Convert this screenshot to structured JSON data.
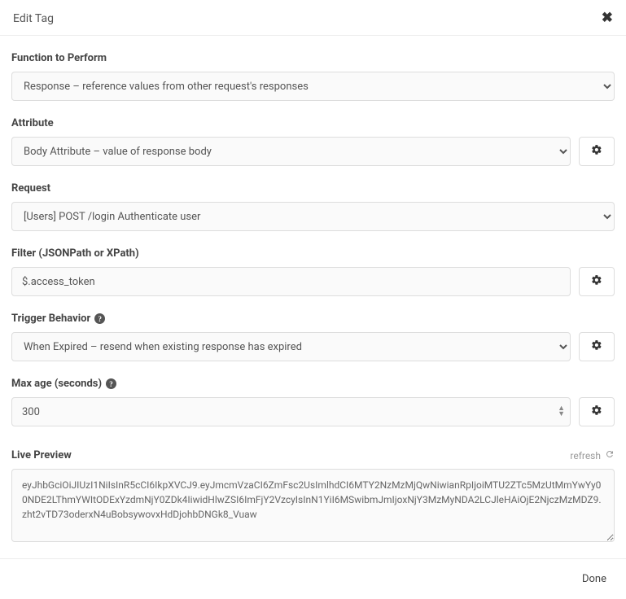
{
  "header": {
    "title": "Edit Tag"
  },
  "fields": {
    "function": {
      "label": "Function to Perform",
      "value": "Response – reference values from other request's responses"
    },
    "attribute": {
      "label": "Attribute",
      "value": "Body Attribute – value of response body"
    },
    "request": {
      "label": "Request",
      "value": "[Users] POST /login Authenticate user"
    },
    "filter": {
      "label": "Filter (JSONPath or XPath)",
      "value": "$.access_token"
    },
    "trigger": {
      "label": "Trigger Behavior",
      "value": "When Expired – resend when existing response has expired"
    },
    "maxage": {
      "label": "Max age (seconds)",
      "value": "300"
    }
  },
  "preview": {
    "label": "Live Preview",
    "refresh_label": "refresh",
    "value": "eyJhbGciOiJIUzI1NiIsInR5cCI6IkpXVCJ9.eyJmcmVzaCI6ZmFsc2UsImlhdCI6MTY2NzMzMjQwNiwianRpIjoiMTU2ZTc5MzUtMmYwYy00NDE2LThmYWItODExYzdmNjY0ZDk4IiwidHlwZSI6ImFjY2VzcyIsInN1YiI6MSwibmJmIjoxNjY3MzMyNDA2LCJleHAiOjE2NjczMzMDZ9.zht2vTD73oderxN4uBobsywovxHdDjohbDNGk8_Vuaw"
  },
  "footer": {
    "done_label": "Done"
  }
}
